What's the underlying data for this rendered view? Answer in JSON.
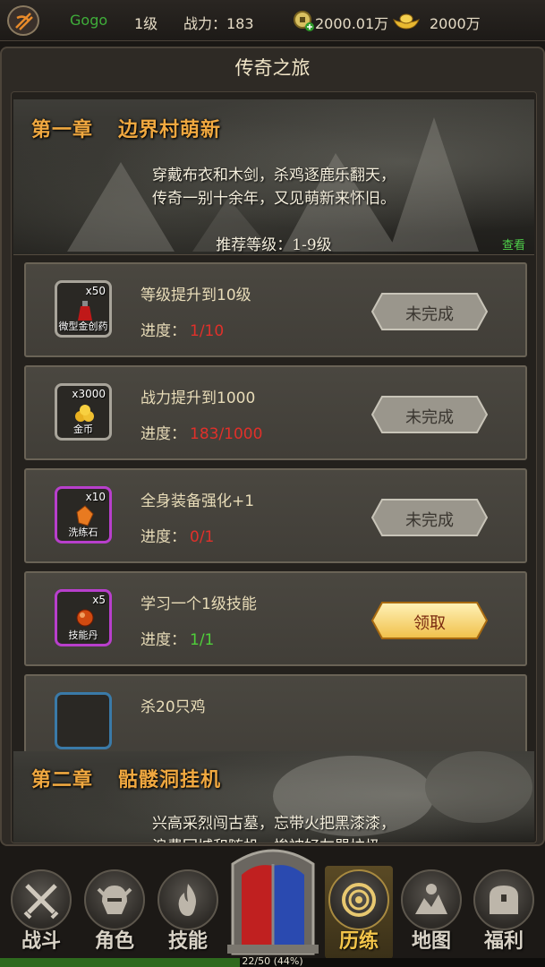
{
  "topbar": {
    "player_name": "Gogo",
    "level": "1级",
    "power": "战力：183",
    "coins": "2000.01万",
    "ingots": "2000万",
    "icons": [
      "logo-icon",
      "coin-add-icon",
      "gold-ingot-icon"
    ]
  },
  "panel": {
    "title": "传奇之旅"
  },
  "chapter1": {
    "title_a": "第一章",
    "title_b": "边界村萌新",
    "poem_line1": "穿戴布衣和木剑，杀鸡逐鹿乐翻天，",
    "poem_line2": "传奇一别十余年，又见萌新来怀旧。",
    "recommend": "推荐等级：1-9级",
    "view_label": "查看"
  },
  "tasks": [
    {
      "item_name": "微型金创药",
      "item_qty": "x50",
      "desc": "等级提升到10级",
      "prog_label": "进度：",
      "prog_value": "1/10",
      "status": "未完成",
      "quality": "gray"
    },
    {
      "item_name": "金币",
      "item_qty": "x3000",
      "desc": "战力提升到1000",
      "prog_label": "进度：",
      "prog_value": "183/1000",
      "status": "未完成",
      "quality": "gray"
    },
    {
      "item_name": "洗练石",
      "item_qty": "x10",
      "desc": "全身装备强化+1",
      "prog_label": "进度：",
      "prog_value": "0/1",
      "status": "未完成",
      "quality": "purple"
    },
    {
      "item_name": "技能丹",
      "item_qty": "x5",
      "desc": "学习一个1级技能",
      "prog_label": "进度：",
      "prog_value": "1/1",
      "status": "领取",
      "quality": "purple"
    },
    {
      "desc": "杀20只鸡"
    }
  ],
  "chapter2": {
    "title_a": "第二章",
    "title_b": "骷髅洞挂机",
    "poem_line1": "兴高采烈闯古墓，忘带火把黑漆漆，",
    "poem_line2": "浪费回城和随机，惨被好友骂垃圾。"
  },
  "nav": {
    "items": [
      {
        "label": "战斗",
        "icon": "crossed-swords-icon"
      },
      {
        "label": "角色",
        "icon": "helmet-icon"
      },
      {
        "label": "技能",
        "icon": "flame-icon"
      },
      {
        "label": "历练",
        "icon": "swirl-icon"
      },
      {
        "label": "地图",
        "icon": "map-pin-icon"
      },
      {
        "label": "福利",
        "icon": "treasure-chest-icon"
      }
    ],
    "active": "历练"
  },
  "exp": {
    "text": "22/50 (44%)",
    "fraction": 0.44
  }
}
